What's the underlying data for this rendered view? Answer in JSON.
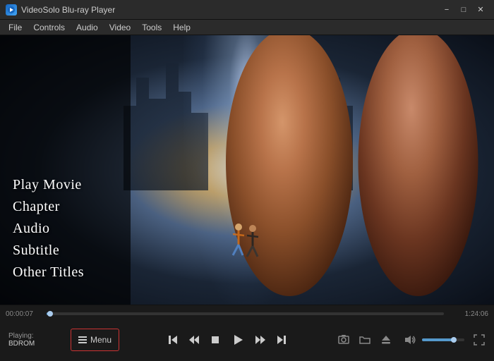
{
  "titlebar": {
    "app_name": "VideoSolo Blu-ray Player",
    "icon_label": "V",
    "minimize": "−",
    "restore": "□",
    "close": "✕"
  },
  "menubar": {
    "items": [
      "File",
      "Controls",
      "Audio",
      "Video",
      "Tools",
      "Help"
    ]
  },
  "disc_menu": {
    "items": [
      "Play Movie",
      "Chapter",
      "Audio",
      "Subtitle",
      "Other Titles"
    ]
  },
  "progress": {
    "current_time": "00:00:07",
    "total_time": "1:24:06",
    "percent": 0.94
  },
  "controls": {
    "playing_label": "Playing:",
    "playing_source": "BDROM",
    "menu_button": "Menu",
    "prev_chapter": "⏮",
    "rewind": "⏪",
    "stop": "⏹",
    "play": "▶",
    "forward": "⏩",
    "next_chapter": "⏭",
    "screenshot": "📷",
    "open_folder": "📁",
    "eject": "⏏",
    "volume_icon": "🔊",
    "fullscreen": "⛶"
  }
}
